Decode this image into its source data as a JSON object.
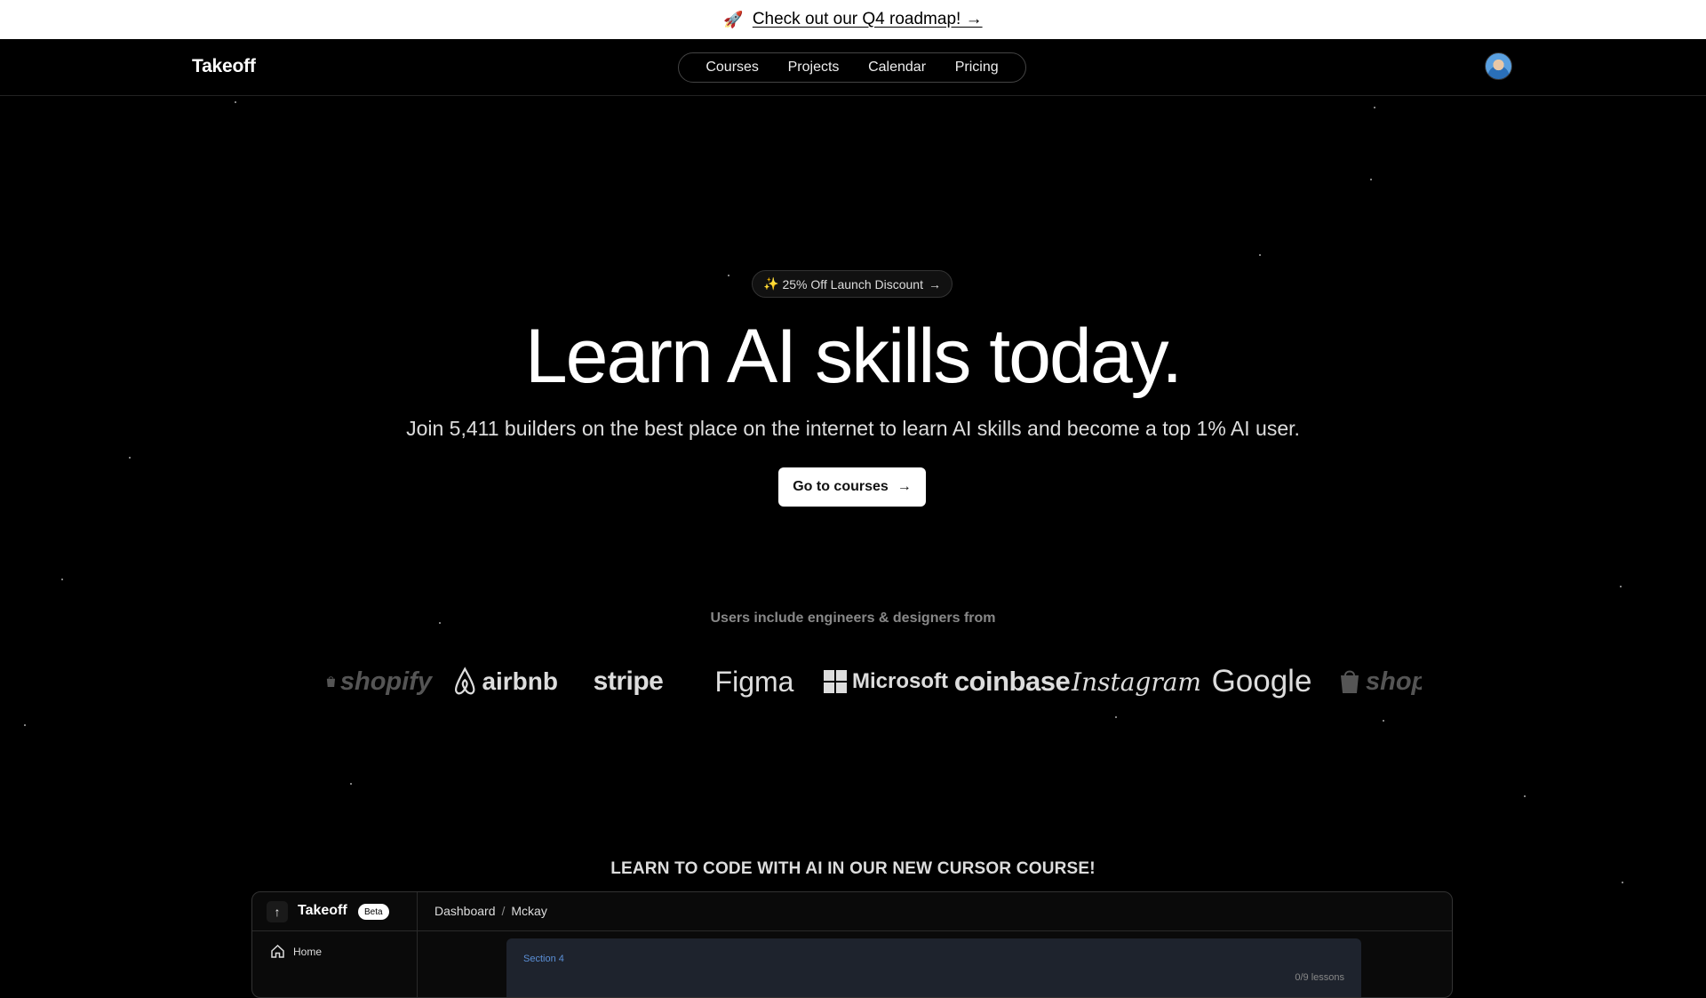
{
  "announcement": {
    "emoji": "🚀",
    "link_text": "Check out our Q4 roadmap! →"
  },
  "header": {
    "brand": "Takeoff",
    "nav": [
      "Courses",
      "Projects",
      "Calendar",
      "Pricing"
    ]
  },
  "hero": {
    "pill_text": "25% Off Launch Discount",
    "pill_icon": "✨",
    "pill_arrow": "→",
    "headline": "Learn AI skills today.",
    "subline": "Join 5,411 builders on the best place on the internet to learn AI skills and become a top 1% AI user.",
    "cta_label": "Go to courses",
    "cta_arrow": "→"
  },
  "users": {
    "label": "Users include engineers & designers from",
    "logos": [
      "shopify",
      "airbnb",
      "stripe",
      "Figma",
      "Microsoft",
      "coinbase",
      "Instagram",
      "Google",
      "shop"
    ]
  },
  "course": {
    "title": "LEARN TO CODE WITH AI IN OUR NEW CURSOR COURSE!"
  },
  "preview": {
    "brand": "Takeoff",
    "badge": "Beta",
    "breadcrumb": [
      "Dashboard",
      "Mckay"
    ],
    "sidebar_home": "Home",
    "section_label": "Section 4",
    "lessons": "0/9 lessons"
  },
  "colors": {
    "background": "#000000",
    "announcement_bg": "#ffffff",
    "cta_bg": "#ffffff",
    "section_accent": "#5b8fd6"
  }
}
